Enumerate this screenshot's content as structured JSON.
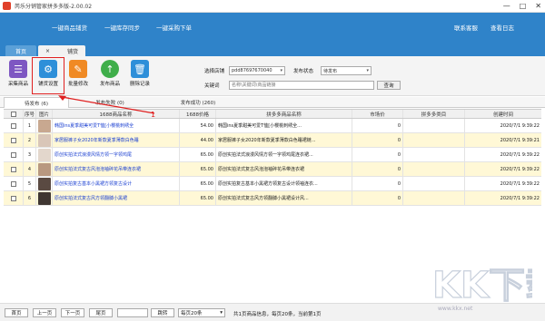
{
  "window": {
    "title": "芮乐分销管家拼多多版-2.00.02",
    "controls": [
      "—",
      "□",
      "✕"
    ]
  },
  "nav": {
    "items": [
      "一键商品铺货",
      "一键库存同步",
      "一键采购下单"
    ],
    "right": [
      "联系客服",
      "查看日志"
    ]
  },
  "tabs": [
    {
      "label": "首页"
    },
    {
      "label": "铺货",
      "close": "×"
    }
  ],
  "toolbar": {
    "buttons": [
      {
        "label": "采集商品",
        "icon": "collect-icon"
      },
      {
        "label": "铺货设置",
        "icon": "gear-icon"
      },
      {
        "label": "批量修改",
        "icon": "pencil-icon"
      },
      {
        "label": "发布商品",
        "icon": "upload-arrow-icon"
      },
      {
        "label": "删除记录",
        "icon": "trash-icon"
      }
    ],
    "shop_label": "选择店铺",
    "shop_value": "pdd87697670040",
    "status_label": "发布状态",
    "status_value": "待发布",
    "keyword_label": "关键词",
    "keyword_placeholder": "名称\\关键词\\商品链接",
    "search_label": "查询"
  },
  "subtabs": [
    {
      "label": "待发布 (6)"
    },
    {
      "label": "发布失败 (0)"
    },
    {
      "label": "发布成功 (260)"
    }
  ],
  "annotation": "1",
  "table": {
    "headers": [
      "",
      "序号",
      "图片",
      "1688商品名称",
      "1688价格",
      "拼多多商品名称",
      "市场价",
      "拼多多类目",
      "创建时间"
    ],
    "rows": [
      {
        "num": "1",
        "title": "韩国ins夏季甜美可爱T恤[小樱桃刺绣全",
        "price": "54.00",
        "pdd_title": "韩国ins夏季甜美可爱T恤[小樱桃刺绣全...",
        "market": "0",
        "category": "",
        "time": "2020/7/1 9:39:22",
        "thumb": "#c8a890"
      },
      {
        "num": "2",
        "title": "家居服裤子女2020年新款夏季薄款白色睡",
        "price": "44.00",
        "pdd_title": "家居服裤子女2020年新款夏季薄款白色睡裙链...",
        "market": "0",
        "category": "",
        "time": "2020/7/1 9:39:21",
        "thumb": "#d9c6b8"
      },
      {
        "num": "3",
        "title": "原创实拍法式浪漫风情方领一字领鸡尾",
        "price": "65.00",
        "pdd_title": "原创实拍法式浪漫风情方领一字领鸡尾连衣裙...",
        "market": "0",
        "category": "",
        "time": "2020/7/1 9:39:22",
        "thumb": "#e3d7cc"
      },
      {
        "num": "4",
        "title": "原创实拍法式复古风泡泡袖碎花吊带连衣裙",
        "price": "65.00",
        "pdd_title": "原创实拍法式复古风泡泡袖碎花吊带连衣裙",
        "market": "0",
        "category": "",
        "time": "2020/7/1 9:39:22",
        "thumb": "#b89880"
      },
      {
        "num": "5",
        "title": "原创实拍复古基本小黑裙方领复古设计",
        "price": "65.00",
        "pdd_title": "原创实拍复古基本小黑裙方领复古设计领袖连衣...",
        "market": "0",
        "category": "",
        "time": "2020/7/1 9:39:22",
        "thumb": "#5a4a42"
      },
      {
        "num": "6",
        "title": "原创实拍法式复古风方领翻膊小黑裙",
        "price": "65.00",
        "pdd_title": "原创实拍法式复古风方领翻膊小黑裙设计风...",
        "market": "0",
        "category": "",
        "time": "2020/7/1 9:39:22",
        "thumb": "#3f3632"
      }
    ]
  },
  "footer": {
    "first": "首页",
    "prev": "上一页",
    "next": "下一页",
    "last": "尾页",
    "jump": "跳转",
    "page_size": "每页20条",
    "info": "共1页商品信息，每页20条，当前第1页"
  },
  "watermark": {
    "brand": "KK下载",
    "url": "www.kkx.net"
  },
  "colors": {
    "nav": "#2f83c9",
    "highlight": "#e02020",
    "row_alt": "#fff8d6",
    "link": "#1a3fd1"
  }
}
